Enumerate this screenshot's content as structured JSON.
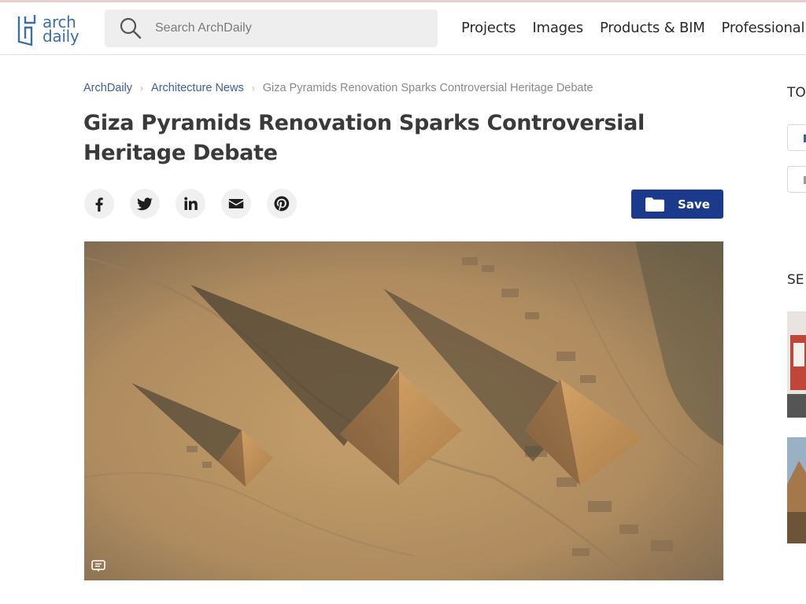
{
  "header": {
    "logo_line1": "arch",
    "logo_line2": "daily",
    "search_placeholder": "Search ArchDaily",
    "nav": [
      "Projects",
      "Images",
      "Products & BIM",
      "Professional"
    ]
  },
  "breadcrumb": {
    "items": [
      "ArchDaily",
      "Architecture News"
    ],
    "current": "Giza Pyramids Renovation Sparks Controversial Heritage Debate"
  },
  "article": {
    "title": "Giza Pyramids Renovation Sparks Controversial Heritage Debate",
    "save_label": "Save"
  },
  "share": [
    "facebook-icon",
    "twitter-icon",
    "linkedin-icon",
    "email-icon",
    "pinterest-icon"
  ],
  "sidebar": {
    "heading_top": "TO",
    "heading_second": "SE"
  },
  "colors": {
    "brand_blue": "#1b3a8c",
    "link_blue": "#3b5fa4",
    "logo_blue": "#3c6fa8",
    "sand": "#b48a55"
  }
}
